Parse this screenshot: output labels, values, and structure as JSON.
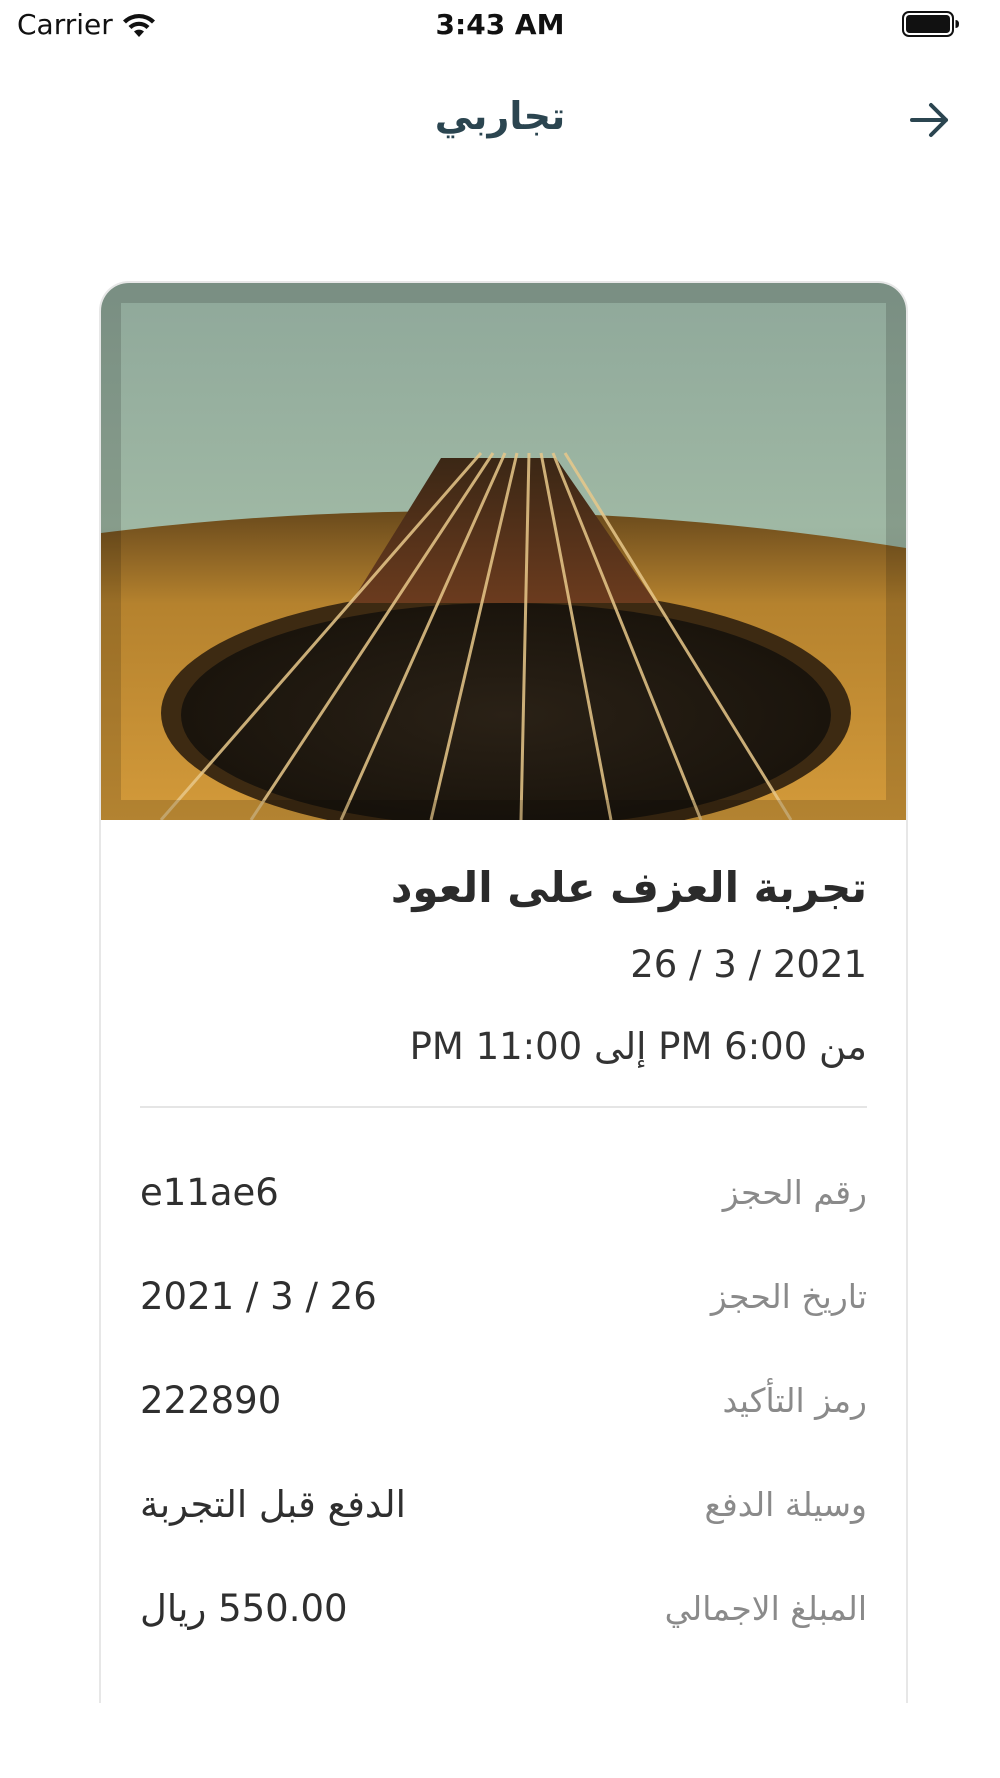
{
  "status_bar": {
    "carrier": "Carrier",
    "time": "3:43 AM"
  },
  "header": {
    "title": "تجاربي",
    "back_icon": "arrow-right-icon"
  },
  "booking": {
    "image_subject": "oud-instrument-photo",
    "title": "تجربة العزف على العود",
    "date": "2021 / 3 / 26",
    "time_range": "من 6:00 PM إلى 11:00 PM",
    "details": [
      {
        "label": "رقم الحجز",
        "value": "e11ae6"
      },
      {
        "label": "تاريخ الحجز",
        "value": "2021 / 3 / 26"
      },
      {
        "label": "رمز التأكيد",
        "value": "222890"
      },
      {
        "label": "وسيلة الدفع",
        "value": "الدفع قبل التجربة"
      },
      {
        "label": "المبلغ الاجمالي",
        "value": "550.00 ريال"
      }
    ]
  },
  "colors": {
    "title": "#2b4550",
    "label": "#8a8a8a",
    "value": "#2f2f2f",
    "divider": "#e5e5e5"
  }
}
